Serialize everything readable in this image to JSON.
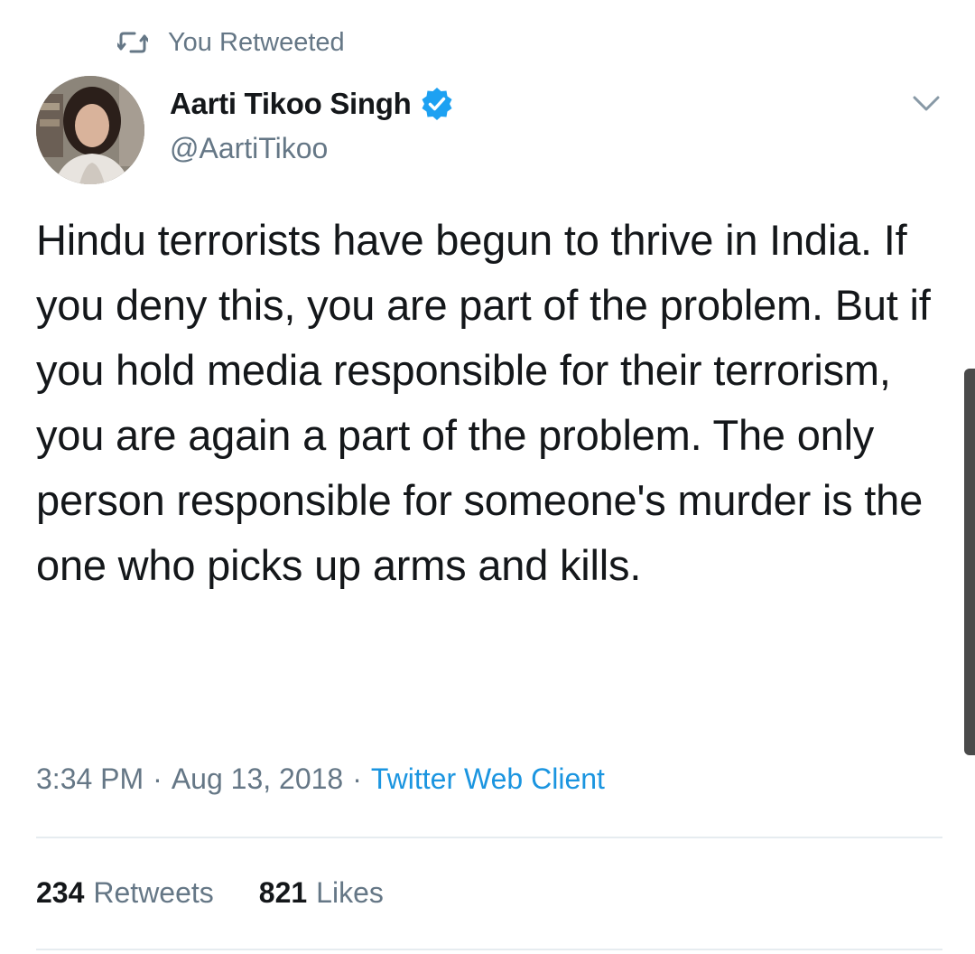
{
  "context": {
    "retweet_icon": "retweet-icon",
    "label": "You Retweeted"
  },
  "author": {
    "display_name": "Aarti Tikoo Singh",
    "handle": "@AartiTikoo",
    "verified": true,
    "verified_icon": "verified-badge-icon",
    "avatar_icon": "user-avatar"
  },
  "menu": {
    "icon": "chevron-down-icon"
  },
  "tweet": {
    "text": "Hindu terrorists have begun to thrive in India. If you deny this, you are part of the problem. But if you hold media responsible for their terrorism, you are again a part of the problem. The only person responsible for someone's murder is the one who picks up arms and kills."
  },
  "meta": {
    "time": "3:34 PM",
    "separator": "·",
    "date": "Aug 13, 2018",
    "source": "Twitter Web Client"
  },
  "stats": {
    "retweets_count": "234",
    "retweets_label": "Retweets",
    "likes_count": "821",
    "likes_label": "Likes"
  },
  "colors": {
    "text_primary": "#14171a",
    "text_secondary": "#657786",
    "link_blue": "#1b95e0",
    "verified_blue": "#1da1f2",
    "divider": "#e6ecf0"
  }
}
